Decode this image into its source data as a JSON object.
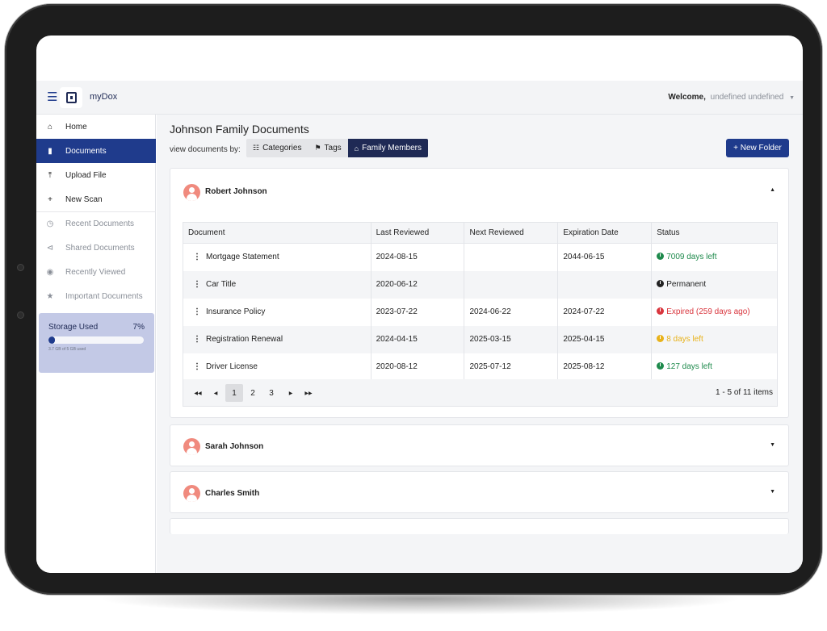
{
  "app": {
    "name": "myDox"
  },
  "header": {
    "welcome_label": "Welcome,",
    "user_name": "undefined undefined"
  },
  "sidebar": {
    "items": [
      {
        "label": "Home",
        "icon": "home-icon"
      },
      {
        "label": "Documents",
        "icon": "document-icon",
        "active": true
      },
      {
        "label": "Upload File",
        "icon": "upload-icon"
      },
      {
        "label": "New Scan",
        "icon": "plus-icon"
      },
      {
        "label": "Recent Documents",
        "icon": "clock-icon"
      },
      {
        "label": "Shared Documents",
        "icon": "share-icon"
      },
      {
        "label": "Recently Viewed",
        "icon": "eye-icon"
      },
      {
        "label": "Important Documents",
        "icon": "star-icon"
      }
    ],
    "storage": {
      "label": "Storage Used",
      "percent_label": "7%",
      "percent": 7,
      "detail": "3.7 GB of 5 GB used"
    }
  },
  "main": {
    "title": "Johnson Family Documents",
    "view_by_label": "view documents by:",
    "view_options": [
      {
        "label": "Categories",
        "icon": "sitemap-icon"
      },
      {
        "label": "Tags",
        "icon": "tag-icon"
      },
      {
        "label": "Family Members",
        "icon": "family-icon",
        "active": true
      }
    ],
    "new_folder_label": "+ New Folder",
    "members": [
      {
        "name": "Robert Johnson",
        "expanded": true
      },
      {
        "name": "Sarah Johnson",
        "expanded": false
      },
      {
        "name": "Charles Smith",
        "expanded": false
      }
    ],
    "table": {
      "columns": [
        "Document",
        "Last Reviewed",
        "Next Reviewed",
        "Expiration Date",
        "Status"
      ],
      "rows": [
        {
          "document": "Mortgage Statement",
          "last": "2024-08-15",
          "next": "",
          "expiration": "2044-06-15",
          "status": "7009 days left",
          "status_color": "green"
        },
        {
          "document": "Car Title",
          "last": "2020-06-12",
          "next": "",
          "expiration": "",
          "status": "Permanent",
          "status_color": "black"
        },
        {
          "document": "Insurance Policy",
          "last": "2023-07-22",
          "next": "2024-06-22",
          "expiration": "2024-07-22",
          "status": "Expired (259 days ago)",
          "status_color": "red"
        },
        {
          "document": "Registration Renewal",
          "last": "2024-04-15",
          "next": "2025-03-15",
          "expiration": "2025-04-15",
          "status": "8 days left",
          "status_color": "yellow"
        },
        {
          "document": "Driver License",
          "last": "2020-08-12",
          "next": "2025-07-12",
          "expiration": "2025-08-12",
          "status": "127 days left",
          "status_color": "green"
        }
      ]
    },
    "pagination": {
      "pages": [
        "1",
        "2",
        "3"
      ],
      "current": "1",
      "info": "1 - 5 of 11 items"
    }
  }
}
